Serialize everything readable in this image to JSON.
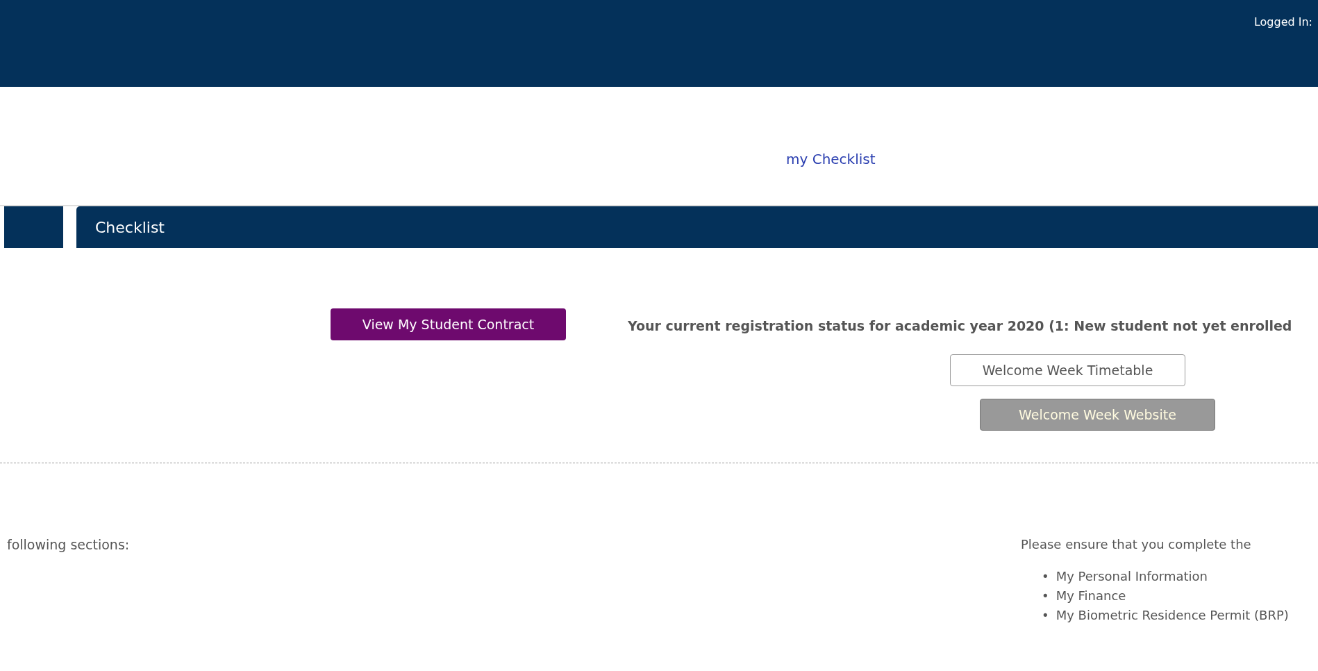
{
  "header": {
    "login_label": "Logged In:"
  },
  "nav": {
    "link": "my Checklist"
  },
  "panel": {
    "title": "Checklist"
  },
  "contract_button": "View My Student Contract",
  "status_text": "Your current registration status for academic year 2020 (1: New student not yet enrolled",
  "buttons": [
    {
      "label": "Welcome Week Timetable",
      "kind": "outline"
    },
    {
      "label": "Welcome Week Website",
      "kind": "grey"
    }
  ],
  "left_note": "following sections:",
  "instructions": {
    "text": "Please ensure that you complete the",
    "items": [
      {
        "bullet": "•",
        "label": "My Personal Information"
      },
      {
        "bullet": "•",
        "label": "My Finance"
      },
      {
        "bullet": "•",
        "label": "My Biometric Residence Permit (BRP)"
      }
    ]
  }
}
